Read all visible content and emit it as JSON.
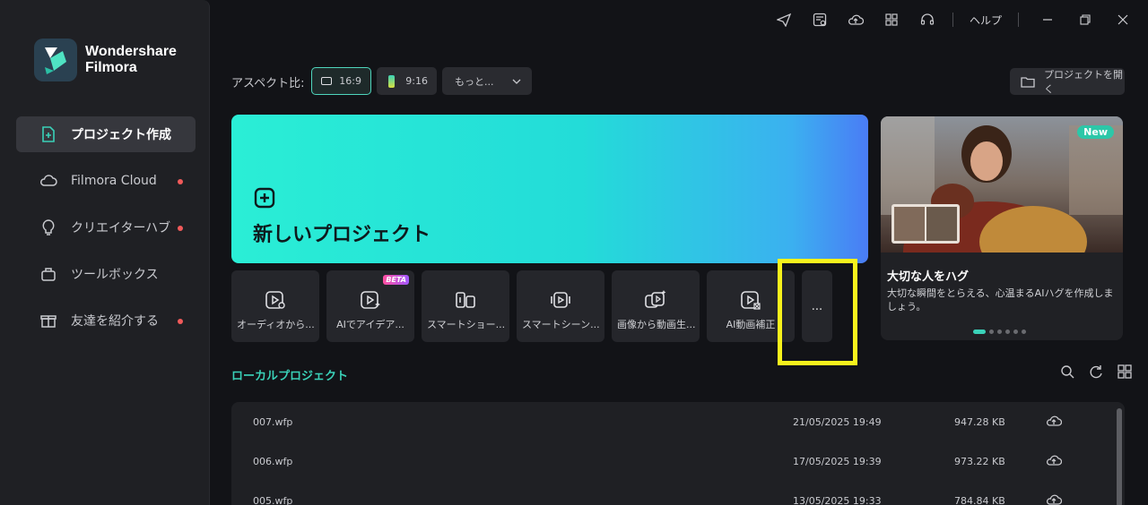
{
  "app": {
    "name_line1": "Wondershare",
    "name_line2": "Filmora"
  },
  "sidebar": {
    "items": [
      {
        "label": "プロジェクト作成",
        "icon": "new-project-icon",
        "active": true,
        "dot": false
      },
      {
        "label": "Filmora Cloud",
        "icon": "cloud-icon",
        "active": false,
        "dot": true
      },
      {
        "label": "クリエイターハブ",
        "icon": "lightbulb-icon",
        "active": false,
        "dot": true
      },
      {
        "label": "ツールボックス",
        "icon": "toolbox-icon",
        "active": false,
        "dot": false
      },
      {
        "label": "友達を紹介する",
        "icon": "gift-icon",
        "active": false,
        "dot": true
      }
    ]
  },
  "topbar": {
    "icons": [
      "send-icon",
      "task-list-icon",
      "cloud-upload-icon",
      "grid-apps-icon",
      "headset-icon"
    ],
    "help_label": "ヘルプ"
  },
  "aspect": {
    "label": "アスペクト比:",
    "options": [
      {
        "label": "16:9",
        "selected": true
      },
      {
        "label": "9:16",
        "selected": false
      }
    ],
    "more_label": "もっと...",
    "open_project_label": "プロジェクトを開く"
  },
  "hero": {
    "title": "新しいプロジェクト"
  },
  "tools": [
    {
      "label": "オーディオから動画生成",
      "icon": "audio-to-video-icon",
      "beta": false
    },
    {
      "label": "AIでアイデアから動画生成",
      "icon": "ai-idea-video-icon",
      "beta": true
    },
    {
      "label": "スマートショートクリップ",
      "icon": "smart-short-clip-icon",
      "beta": false
    },
    {
      "label": "スマートシーンカット",
      "icon": "smart-scene-cut-icon",
      "beta": false
    },
    {
      "label": "画像から動画生成",
      "icon": "image-to-video-icon",
      "beta": false
    },
    {
      "label": "AI動画補正",
      "icon": "ai-video-enhance-icon",
      "beta": false
    }
  ],
  "beta_label": "BETA",
  "more_tools_label": "...",
  "promo": {
    "badge": "New",
    "title": "大切な人をハグ",
    "description": "大切な瞬間をとらえる、心温まるAIハグを作成しましょう。",
    "slides": 6,
    "active_slide": 0
  },
  "local": {
    "title": "ローカルプロジェクト",
    "projects": [
      {
        "name": "007.wfp",
        "date": "21/05/2025 19:49",
        "size": "947.28 KB"
      },
      {
        "name": "006.wfp",
        "date": "17/05/2025 19:39",
        "size": "973.22 KB"
      },
      {
        "name": "005.wfp",
        "date": "13/05/2025 19:33",
        "size": "784.84 KB"
      }
    ]
  },
  "colors": {
    "accent": "#3ad1b8",
    "highlight": "#f7f21c",
    "notification_dot": "#f15a5a"
  }
}
